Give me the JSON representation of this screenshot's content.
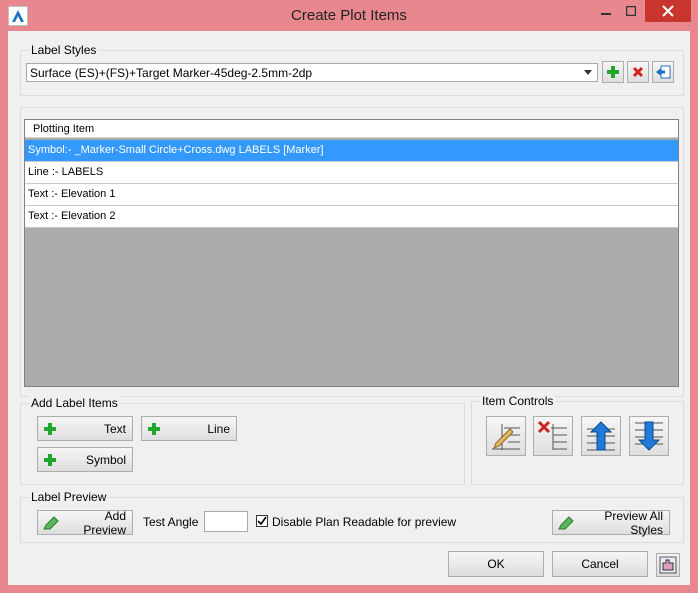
{
  "window": {
    "title": "Create Plot Items"
  },
  "label_styles": {
    "group_label": "Label Styles",
    "selected": "Surface (ES)+(FS)+Target Marker-45deg-2.5mm-2dp"
  },
  "plot_list": {
    "header": "Plotting Item",
    "rows": [
      {
        "text": "Symbol:-  _Marker-Small Circle+Cross.dwg LABELS [Marker]"
      },
      {
        "text": "Line :-  LABELS"
      },
      {
        "text": "Text :- Elevation 1"
      },
      {
        "text": "Text :- Elevation 2"
      }
    ]
  },
  "add_label_items": {
    "group_label": "Add Label Items",
    "text_label": "Text",
    "line_label": "Line",
    "symbol_label": "Symbol"
  },
  "item_controls": {
    "group_label": "Item Controls"
  },
  "label_preview": {
    "group_label": "Label Preview",
    "add_preview_label": "Add Preview",
    "test_angle_label": "Test Angle",
    "test_angle_value": "",
    "disable_plan_readable_label": "Disable Plan Readable for preview",
    "disable_plan_readable_checked": true,
    "preview_all_label": "Preview All Styles"
  },
  "footer": {
    "ok_label": "OK",
    "cancel_label": "Cancel"
  },
  "colors": {
    "selection": "#3399ff",
    "add_green": "#22a52b",
    "delete_red": "#d3231e",
    "arrow_blue": "#1f7ad8",
    "frame": "#e8878d"
  }
}
